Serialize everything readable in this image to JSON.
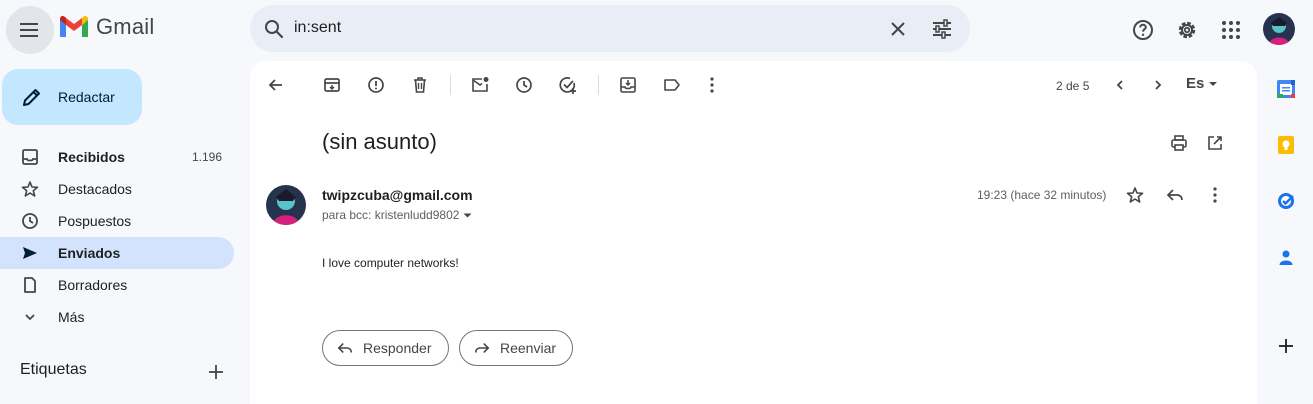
{
  "header": {
    "app_name": "Gmail",
    "search_value": "in:sent"
  },
  "compose": {
    "label": "Redactar"
  },
  "nav": [
    {
      "label": "Recibidos",
      "count": "1.196",
      "icon": "inbox-icon"
    },
    {
      "label": "Destacados",
      "count": "",
      "icon": "star-icon"
    },
    {
      "label": "Pospuestos",
      "count": "",
      "icon": "clock-icon"
    },
    {
      "label": "Enviados",
      "count": "",
      "icon": "send-icon"
    },
    {
      "label": "Borradores",
      "count": "",
      "icon": "draft-icon"
    },
    {
      "label": "Más",
      "count": "",
      "icon": "chevron-down-icon"
    }
  ],
  "labels": {
    "heading": "Etiquetas"
  },
  "toolbar": {
    "pager": "2 de 5",
    "language": "Es"
  },
  "email": {
    "subject": "(sin asunto)",
    "sender": "twipzcuba@gmail.com",
    "recipients": "para bcc: kristenludd9802",
    "time": "19:23 (hace 32 minutos)",
    "body": "I love computer networks!"
  },
  "actions": {
    "reply_label": "Responder",
    "forward_label": "Reenviar"
  },
  "colors": {
    "compose_bg": "#c2e7ff",
    "active_nav_bg": "#d3e3fd",
    "search_bg": "#e9eef6"
  }
}
